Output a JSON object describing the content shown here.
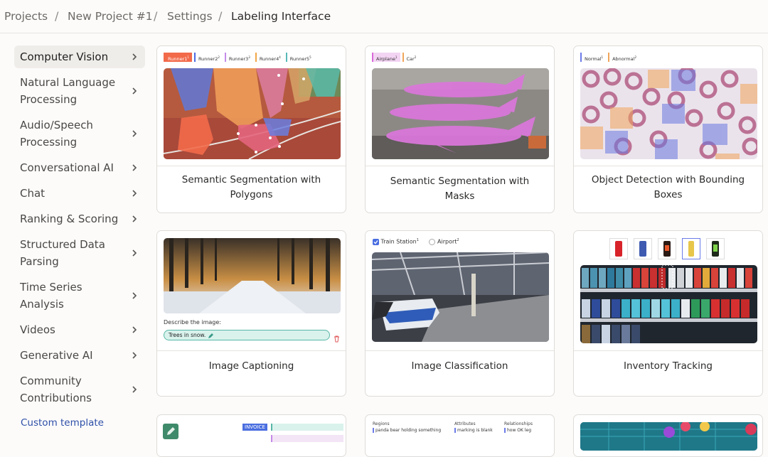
{
  "breadcrumb": [
    "Projects",
    "New Project #1",
    "Settings",
    "Labeling Interface"
  ],
  "sidebar": {
    "items": [
      {
        "label": "Computer Vision",
        "active": true
      },
      {
        "label": "Natural Language Processing"
      },
      {
        "label": "Audio/Speech Processing"
      },
      {
        "label": "Conversational AI"
      },
      {
        "label": "Chat"
      },
      {
        "label": "Ranking & Scoring"
      },
      {
        "label": "Structured Data Parsing"
      },
      {
        "label": "Time Series Analysis"
      },
      {
        "label": "Videos"
      },
      {
        "label": "Generative AI"
      },
      {
        "label": "Community Contributions"
      }
    ],
    "custom_template": "Custom template"
  },
  "cards": [
    {
      "title": "Semantic Segmentation with Polygons",
      "labels": [
        {
          "name": "Runner1",
          "hotkey": "1",
          "color": "#f26a4a"
        },
        {
          "name": "Runner2",
          "hotkey": "2",
          "color": "#4b6ae3"
        },
        {
          "name": "Runner3",
          "hotkey": "3",
          "color": "#c58be8"
        },
        {
          "name": "Runner4",
          "hotkey": "4",
          "color": "#f2a64a"
        },
        {
          "name": "Runner5",
          "hotkey": "5",
          "color": "#58b9b8"
        }
      ]
    },
    {
      "title": "Semantic Segmentation with Masks",
      "labels": [
        {
          "name": "Airplane",
          "hotkey": "1",
          "color": "#d86ad8"
        },
        {
          "name": "Car",
          "hotkey": "2",
          "color": "#f0a55a"
        }
      ]
    },
    {
      "title": "Object Detection with Bounding Boxes",
      "labels": [
        {
          "name": "Normal",
          "hotkey": "1",
          "color": "#6b7ce8"
        },
        {
          "name": "Abnormal",
          "hotkey": "2",
          "color": "#f0a55a"
        }
      ]
    },
    {
      "title": "Image Captioning",
      "prompt": "Describe the image:",
      "caption": "Trees in snow."
    },
    {
      "title": "Image Classification",
      "choices": [
        {
          "name": "Train Station",
          "hotkey": "1",
          "checked": true
        },
        {
          "name": "Airport",
          "hotkey": "2",
          "checked": false
        }
      ]
    },
    {
      "title": "Inventory Tracking"
    }
  ],
  "partial_cards": {
    "invoice_label": "INVOICE",
    "ner_headers": [
      "Regions",
      "Attributes",
      "Relationships"
    ],
    "ner_items": [
      "panda bear holding something",
      "marking is blank",
      "how OK leg"
    ]
  },
  "colors": {
    "accent": "#2e4fa8",
    "card_border": "#dfdcd8",
    "active_bg": "#efedea"
  }
}
